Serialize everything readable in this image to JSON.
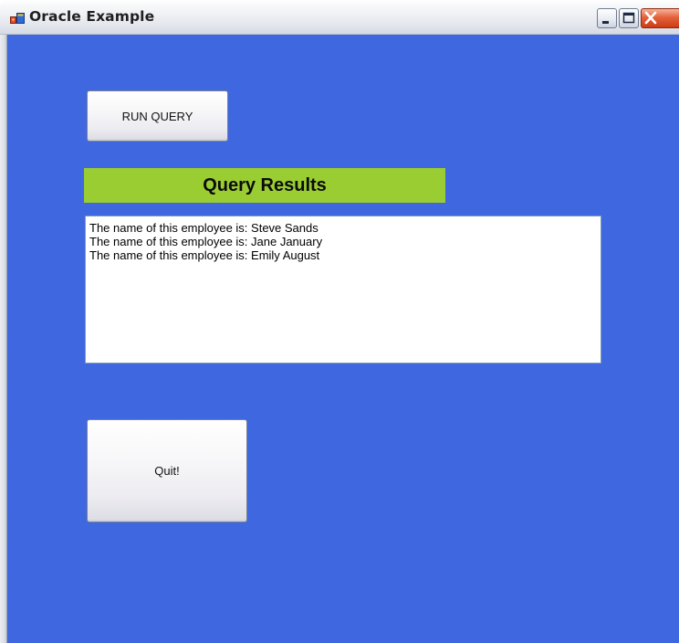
{
  "window": {
    "title": "Oracle Example",
    "icon": "app-window-icon"
  },
  "titlebar_buttons": {
    "minimize_icon": "minimize-icon",
    "maximize_icon": "maximize-icon",
    "close_icon": "close-icon"
  },
  "toolbar": {
    "run_query_label": "RUN QUERY"
  },
  "results": {
    "header": "Query Results",
    "items": [
      "The name of this employee is: Steve Sands",
      "The name of this employee is: Jane January",
      "The name of this employee is: Emily August"
    ]
  },
  "actions": {
    "quit_label": "Quit!"
  },
  "colors": {
    "background": "#3f67e0",
    "header_bg": "#9acd32",
    "close_button": "#cc3b16"
  }
}
